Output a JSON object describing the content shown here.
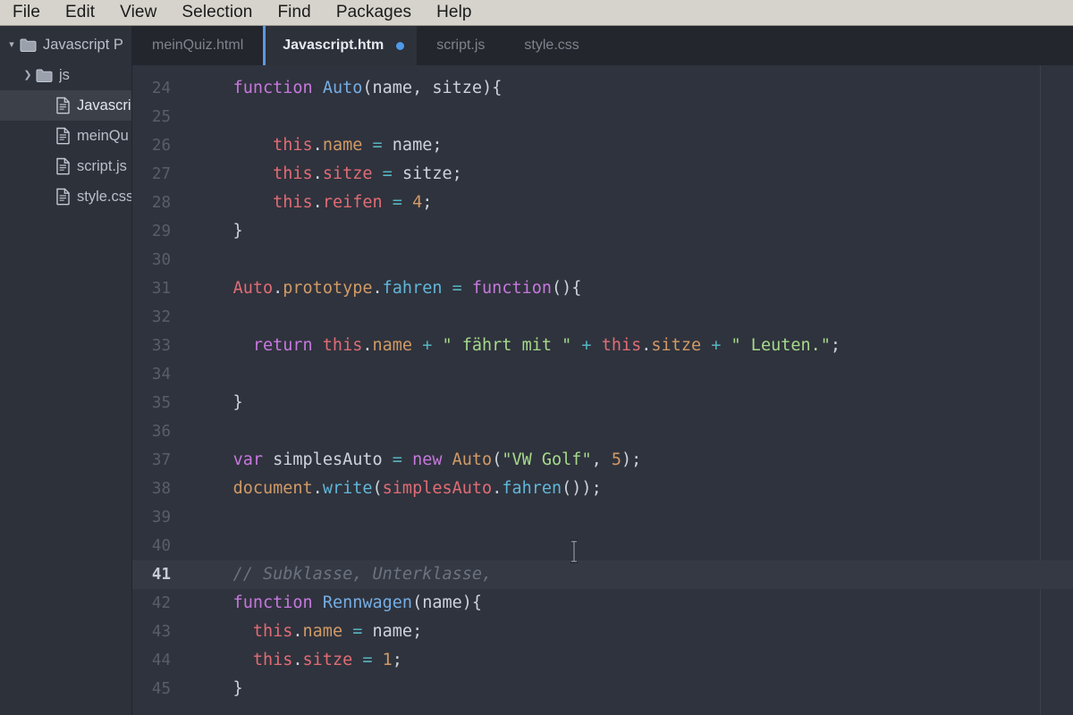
{
  "menubar": {
    "items": [
      {
        "label": "File"
      },
      {
        "label": "Edit"
      },
      {
        "label": "View"
      },
      {
        "label": "Selection"
      },
      {
        "label": "Find"
      },
      {
        "label": "Packages"
      },
      {
        "label": "Help"
      }
    ]
  },
  "sidebar": {
    "items": [
      {
        "label": "Javascript P",
        "icon": "folder-icon",
        "twisty": "▾",
        "depth": 0,
        "selected": false
      },
      {
        "label": "js",
        "icon": "folder-icon",
        "twisty": "❯",
        "depth": 1,
        "selected": false
      },
      {
        "label": "Javascrip",
        "icon": "file-icon",
        "twisty": "",
        "depth": 2,
        "selected": true
      },
      {
        "label": "meinQu",
        "icon": "file-icon",
        "twisty": "",
        "depth": 2,
        "selected": false
      },
      {
        "label": "script.js",
        "icon": "file-icon",
        "twisty": "",
        "depth": 2,
        "selected": false
      },
      {
        "label": "style.css",
        "icon": "file-icon",
        "twisty": "",
        "depth": 2,
        "selected": false
      }
    ]
  },
  "tabs": [
    {
      "label": "meinQuiz.html",
      "active": false,
      "modified": false
    },
    {
      "label": "Javascript.htm",
      "active": true,
      "modified": true
    },
    {
      "label": "script.js",
      "active": false,
      "modified": false
    },
    {
      "label": "style.css",
      "active": false,
      "modified": false
    }
  ],
  "editor": {
    "active_line": 41,
    "accent_color": "#5a9ae0",
    "background_color": "#2f333d",
    "gutter_color": "#585e6a",
    "lines": [
      {
        "n": 24,
        "tokens": [
          {
            "t": "    ",
            "c": "punc"
          },
          {
            "t": "function",
            "c": "kw"
          },
          {
            "t": " ",
            "c": "punc"
          },
          {
            "t": "Auto",
            "c": "fnname"
          },
          {
            "t": "(",
            "c": "punc"
          },
          {
            "t": "name",
            "c": "param"
          },
          {
            "t": ", ",
            "c": "punc"
          },
          {
            "t": "sitze",
            "c": "param"
          },
          {
            "t": "){",
            "c": "punc"
          }
        ]
      },
      {
        "n": 25,
        "tokens": []
      },
      {
        "n": 26,
        "tokens": [
          {
            "t": "        ",
            "c": "punc"
          },
          {
            "t": "this",
            "c": "this"
          },
          {
            "t": ".",
            "c": "punc"
          },
          {
            "t": "name",
            "c": "prop"
          },
          {
            "t": " ",
            "c": "punc"
          },
          {
            "t": "=",
            "c": "op"
          },
          {
            "t": " ",
            "c": "punc"
          },
          {
            "t": "name",
            "c": "param"
          },
          {
            "t": ";",
            "c": "punc"
          }
        ]
      },
      {
        "n": 27,
        "tokens": [
          {
            "t": "        ",
            "c": "punc"
          },
          {
            "t": "this",
            "c": "this"
          },
          {
            "t": ".",
            "c": "punc"
          },
          {
            "t": "sitze",
            "c": "this"
          },
          {
            "t": " ",
            "c": "punc"
          },
          {
            "t": "=",
            "c": "op"
          },
          {
            "t": " ",
            "c": "punc"
          },
          {
            "t": "sitze",
            "c": "param"
          },
          {
            "t": ";",
            "c": "punc"
          }
        ]
      },
      {
        "n": 28,
        "tokens": [
          {
            "t": "        ",
            "c": "punc"
          },
          {
            "t": "this",
            "c": "this"
          },
          {
            "t": ".",
            "c": "punc"
          },
          {
            "t": "reifen",
            "c": "this"
          },
          {
            "t": " ",
            "c": "punc"
          },
          {
            "t": "=",
            "c": "op"
          },
          {
            "t": " ",
            "c": "punc"
          },
          {
            "t": "4",
            "c": "num"
          },
          {
            "t": ";",
            "c": "punc"
          }
        ]
      },
      {
        "n": 29,
        "tokens": [
          {
            "t": "    }",
            "c": "punc"
          }
        ]
      },
      {
        "n": 30,
        "tokens": []
      },
      {
        "n": 31,
        "tokens": [
          {
            "t": "    ",
            "c": "punc"
          },
          {
            "t": "Auto",
            "c": "this"
          },
          {
            "t": ".",
            "c": "punc"
          },
          {
            "t": "prototype",
            "c": "prop"
          },
          {
            "t": ".",
            "c": "punc"
          },
          {
            "t": "fahren",
            "c": "method"
          },
          {
            "t": " ",
            "c": "punc"
          },
          {
            "t": "=",
            "c": "op"
          },
          {
            "t": " ",
            "c": "punc"
          },
          {
            "t": "function",
            "c": "kw"
          },
          {
            "t": "(){",
            "c": "punc"
          }
        ]
      },
      {
        "n": 32,
        "tokens": []
      },
      {
        "n": 33,
        "tokens": [
          {
            "t": "      ",
            "c": "punc"
          },
          {
            "t": "return",
            "c": "kw"
          },
          {
            "t": " ",
            "c": "punc"
          },
          {
            "t": "this",
            "c": "this"
          },
          {
            "t": ".",
            "c": "punc"
          },
          {
            "t": "name",
            "c": "prop"
          },
          {
            "t": " ",
            "c": "punc"
          },
          {
            "t": "+",
            "c": "op"
          },
          {
            "t": " ",
            "c": "punc"
          },
          {
            "t": "\" fährt mit \"",
            "c": "str"
          },
          {
            "t": " ",
            "c": "punc"
          },
          {
            "t": "+",
            "c": "op"
          },
          {
            "t": " ",
            "c": "punc"
          },
          {
            "t": "this",
            "c": "this"
          },
          {
            "t": ".",
            "c": "punc"
          },
          {
            "t": "sitze",
            "c": "prop"
          },
          {
            "t": " ",
            "c": "punc"
          },
          {
            "t": "+",
            "c": "op"
          },
          {
            "t": " ",
            "c": "punc"
          },
          {
            "t": "\" Leuten.\"",
            "c": "str"
          },
          {
            "t": ";",
            "c": "punc"
          }
        ]
      },
      {
        "n": 34,
        "tokens": []
      },
      {
        "n": 35,
        "tokens": [
          {
            "t": "    }",
            "c": "punc"
          }
        ]
      },
      {
        "n": 36,
        "tokens": []
      },
      {
        "n": 37,
        "tokens": [
          {
            "t": "    ",
            "c": "punc"
          },
          {
            "t": "var",
            "c": "kw"
          },
          {
            "t": " ",
            "c": "punc"
          },
          {
            "t": "simplesAuto",
            "c": "param"
          },
          {
            "t": " ",
            "c": "punc"
          },
          {
            "t": "=",
            "c": "op"
          },
          {
            "t": " ",
            "c": "punc"
          },
          {
            "t": "new",
            "c": "kw"
          },
          {
            "t": " ",
            "c": "punc"
          },
          {
            "t": "Auto",
            "c": "prop"
          },
          {
            "t": "(",
            "c": "punc"
          },
          {
            "t": "\"VW Golf\"",
            "c": "str"
          },
          {
            "t": ", ",
            "c": "punc"
          },
          {
            "t": "5",
            "c": "num"
          },
          {
            "t": ");",
            "c": "punc"
          }
        ]
      },
      {
        "n": 38,
        "tokens": [
          {
            "t": "    ",
            "c": "punc"
          },
          {
            "t": "document",
            "c": "prop"
          },
          {
            "t": ".",
            "c": "punc"
          },
          {
            "t": "write",
            "c": "method"
          },
          {
            "t": "(",
            "c": "punc"
          },
          {
            "t": "simplesAuto",
            "c": "this"
          },
          {
            "t": ".",
            "c": "punc"
          },
          {
            "t": "fahren",
            "c": "method"
          },
          {
            "t": "());",
            "c": "punc"
          }
        ]
      },
      {
        "n": 39,
        "tokens": []
      },
      {
        "n": 40,
        "tokens": []
      },
      {
        "n": 41,
        "tokens": [
          {
            "t": "    ",
            "c": "punc"
          },
          {
            "t": "// Subklasse, Unterklasse,",
            "c": "cmt"
          }
        ]
      },
      {
        "n": 42,
        "tokens": [
          {
            "t": "    ",
            "c": "punc"
          },
          {
            "t": "function",
            "c": "kw"
          },
          {
            "t": " ",
            "c": "punc"
          },
          {
            "t": "Rennwagen",
            "c": "fnname"
          },
          {
            "t": "(",
            "c": "punc"
          },
          {
            "t": "name",
            "c": "param"
          },
          {
            "t": "){",
            "c": "punc"
          }
        ]
      },
      {
        "n": 43,
        "tokens": [
          {
            "t": "      ",
            "c": "punc"
          },
          {
            "t": "this",
            "c": "this"
          },
          {
            "t": ".",
            "c": "punc"
          },
          {
            "t": "name",
            "c": "prop"
          },
          {
            "t": " ",
            "c": "punc"
          },
          {
            "t": "=",
            "c": "op"
          },
          {
            "t": " ",
            "c": "punc"
          },
          {
            "t": "name",
            "c": "param"
          },
          {
            "t": ";",
            "c": "punc"
          }
        ]
      },
      {
        "n": 44,
        "tokens": [
          {
            "t": "      ",
            "c": "punc"
          },
          {
            "t": "this",
            "c": "this"
          },
          {
            "t": ".",
            "c": "punc"
          },
          {
            "t": "sitze",
            "c": "this"
          },
          {
            "t": " ",
            "c": "punc"
          },
          {
            "t": "=",
            "c": "op"
          },
          {
            "t": " ",
            "c": "punc"
          },
          {
            "t": "1",
            "c": "num"
          },
          {
            "t": ";",
            "c": "punc"
          }
        ]
      },
      {
        "n": 45,
        "tokens": [
          {
            "t": "    }",
            "c": "punc"
          }
        ]
      }
    ]
  }
}
